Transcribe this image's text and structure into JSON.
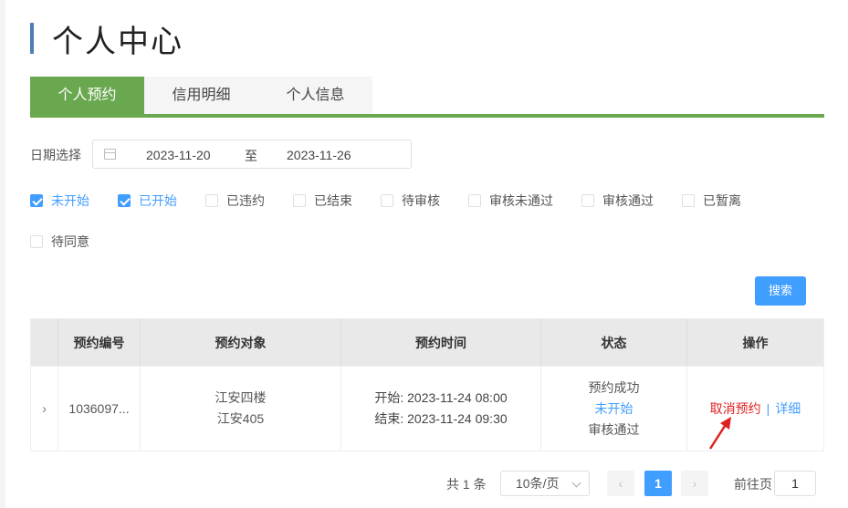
{
  "page": {
    "title": "个人中心"
  },
  "tabs": [
    {
      "label": "个人预约",
      "active": true
    },
    {
      "label": "信用明细",
      "active": false
    },
    {
      "label": "个人信息",
      "active": false
    }
  ],
  "filters": {
    "date_label": "日期选择",
    "date_start": "2023-11-20",
    "date_separator": "至",
    "date_end": "2023-11-26",
    "statuses": [
      {
        "label": "未开始",
        "checked": true
      },
      {
        "label": "已开始",
        "checked": true
      },
      {
        "label": "已违约",
        "checked": false
      },
      {
        "label": "已结束",
        "checked": false
      },
      {
        "label": "待审核",
        "checked": false
      },
      {
        "label": "审核未通过",
        "checked": false
      },
      {
        "label": "审核通过",
        "checked": false
      },
      {
        "label": "已暂离",
        "checked": false
      },
      {
        "label": "待同意",
        "checked": false
      }
    ],
    "search_label": "搜索"
  },
  "table": {
    "headers": [
      "预约编号",
      "预约对象",
      "预约时间",
      "状态",
      "操作"
    ],
    "rows": [
      {
        "id": "1036097...",
        "object_line1": "江安四楼",
        "object_line2": "江安405",
        "time_start": "开始: 2023-11-24 08:00",
        "time_end": "结束: 2023-11-24 09:30",
        "status1": "预约成功",
        "status2": "未开始",
        "status3": "审核通过",
        "action_cancel": "取消预约",
        "action_sep": "|",
        "action_detail": "详细"
      }
    ]
  },
  "pagination": {
    "total": "共 1 条",
    "page_size": "10条/页",
    "prev": "‹",
    "current": "1",
    "next": "›",
    "goto_label": "前往页",
    "goto_value": "1"
  },
  "colors": {
    "accent_green": "#6aa84f",
    "primary_blue": "#409eff",
    "danger_red": "#e02020"
  }
}
